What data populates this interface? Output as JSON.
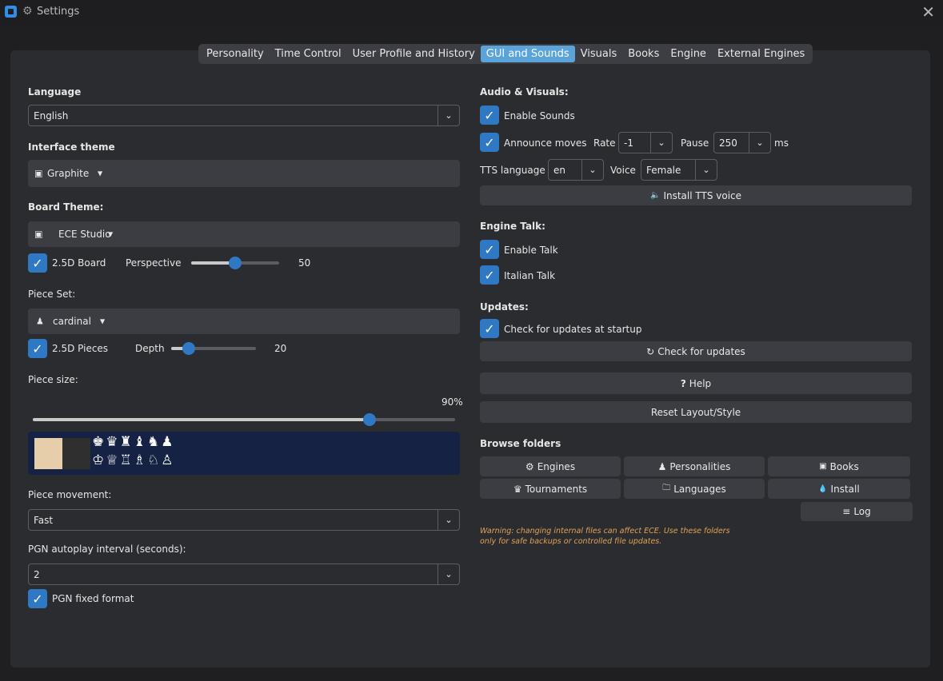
{
  "window": {
    "title": "Settings",
    "close_label": "✕"
  },
  "tabs": [
    {
      "label": "Personality"
    },
    {
      "label": "Time Control"
    },
    {
      "label": "User Profile and History"
    },
    {
      "label": "GUI and Sounds",
      "active": true
    },
    {
      "label": "Visuals"
    },
    {
      "label": "Books"
    },
    {
      "label": "Engine"
    },
    {
      "label": "External Engines"
    }
  ],
  "left": {
    "language": {
      "label": "Language",
      "value": "English"
    },
    "interface_theme": {
      "label": "Interface theme",
      "value": "Graphite"
    },
    "board_theme": {
      "label": "Board Theme:",
      "value": "ECE Studio"
    },
    "board_25d": {
      "label": "2.5D Board",
      "checked": true
    },
    "perspective": {
      "label": "Perspective",
      "value": "50",
      "fraction": 0.5
    },
    "piece_set": {
      "label": "Piece Set:",
      "value": "cardinal"
    },
    "pieces_25d": {
      "label": "2.5D Pieces",
      "checked": true
    },
    "depth": {
      "label": "Depth",
      "value": "20",
      "fraction": 0.2
    },
    "piece_size": {
      "label": "Piece size:",
      "value": "90%",
      "fraction": 0.9
    },
    "preview": {
      "white_row": "♔♕♖♗♘♙",
      "black_row": "♚♛♜♝♞♟"
    },
    "piece_movement": {
      "label": "Piece movement:",
      "value": "Fast"
    },
    "pgn_autoplay": {
      "label": "PGN autoplay interval (seconds):",
      "value": "2"
    },
    "pgn_fixed": {
      "label": "PGN fixed format",
      "checked": true
    }
  },
  "right": {
    "audio_title": "Audio & Visuals:",
    "enable_sounds": {
      "label": "Enable Sounds",
      "checked": true
    },
    "announce_moves": {
      "label": "Announce moves",
      "checked": true
    },
    "rate": {
      "label": "Rate",
      "value": "-1"
    },
    "pause": {
      "label": "Pause",
      "value": "250",
      "unit": "ms"
    },
    "tts_language": {
      "label": "TTS language",
      "value": "en"
    },
    "voice": {
      "label": "Voice",
      "value": "Female"
    },
    "install_tts": {
      "label": "Install TTS voice"
    },
    "engine_talk_title": "Engine Talk:",
    "enable_talk": {
      "label": "Enable Talk",
      "checked": true
    },
    "italian_talk": {
      "label": "Italian Talk",
      "checked": true
    },
    "updates_title": "Updates:",
    "check_startup": {
      "label": "Check for updates at startup",
      "checked": true
    },
    "check_updates": {
      "label": "Check for updates"
    },
    "help": {
      "label": "Help"
    },
    "reset_layout": {
      "label": "Reset Layout/Style"
    },
    "browse_title": "Browse folders",
    "folders": {
      "engines": "Engines",
      "personalities": "Personalities",
      "books": "Books",
      "tournaments": "Tournaments",
      "languages": "Languages",
      "install": "Install",
      "log": "Log"
    },
    "warning": "Warning: changing internal files can affect ECE. Use these folders only for safe backups or controlled file updates."
  },
  "icons": {
    "checkmark": "✓",
    "chevron": "⌄",
    "caret": "▼",
    "theme_icon": "▣",
    "pawn_icon": "♟",
    "speaker_icon": "🔈",
    "refresh_icon": "↻",
    "help_icon": "?",
    "gear_icon": "⚙",
    "crown_icon": "♛",
    "folder_icon": "🗀",
    "drop_icon": "💧",
    "menu_icon": "≡"
  },
  "colors": {
    "accent": "#2f78c4",
    "tab_active": "#5aa4da",
    "warning": "#e3a155",
    "preview_bg": "#162244"
  }
}
